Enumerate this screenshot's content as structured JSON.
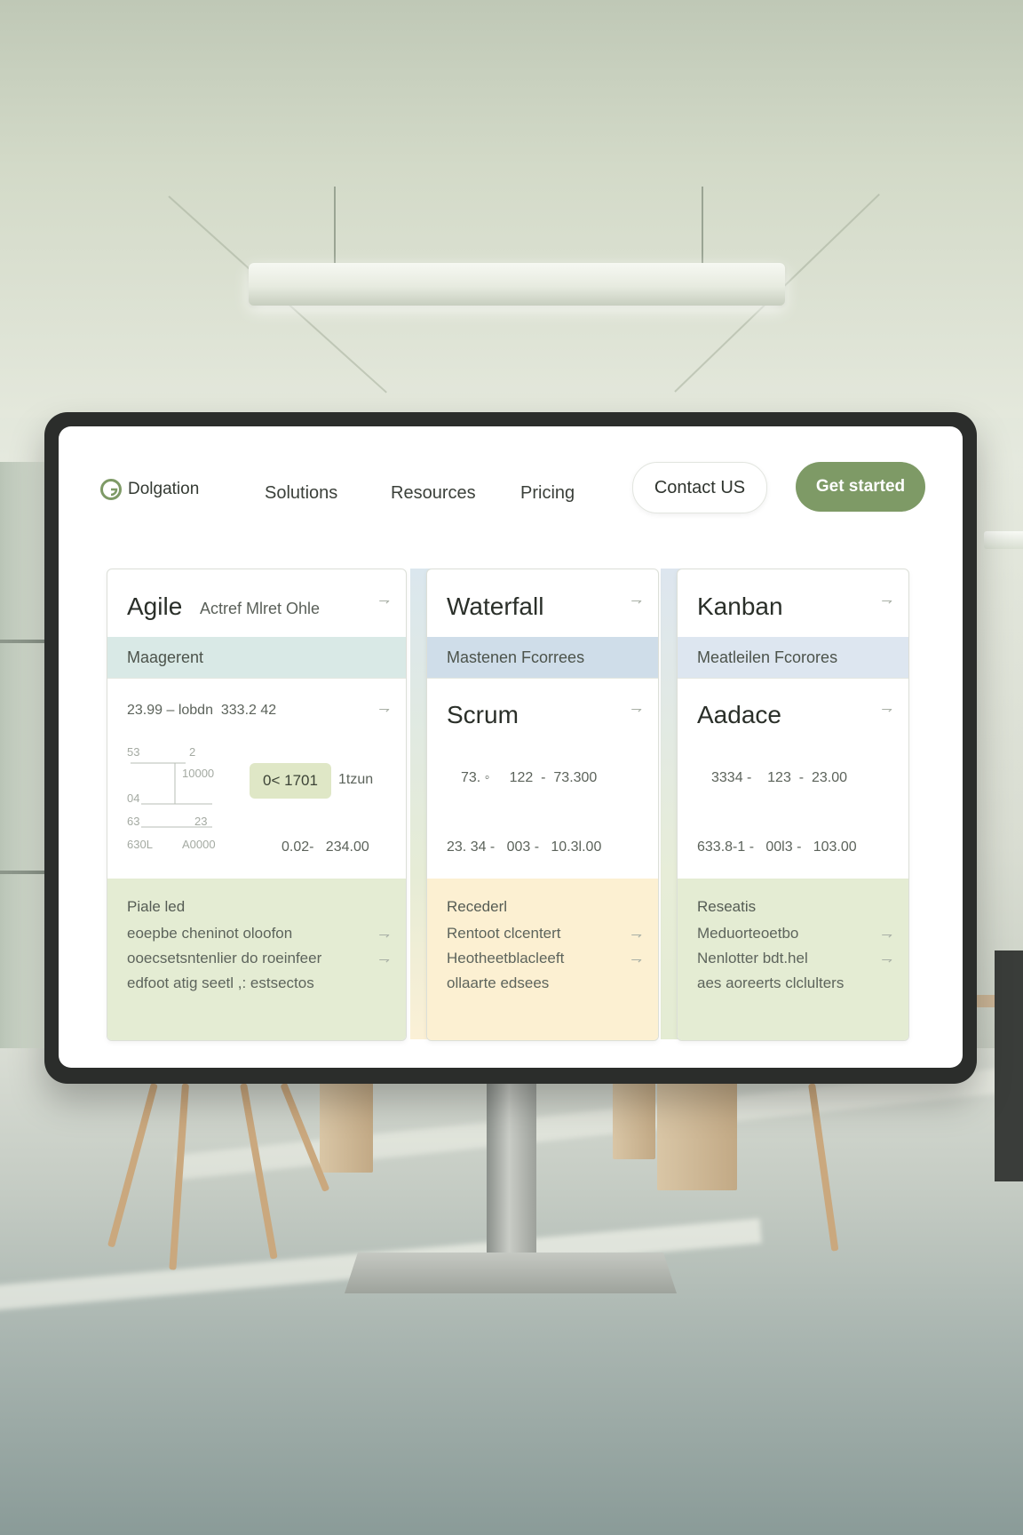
{
  "nav": {
    "brand": "Dolgation",
    "links": [
      "Solutions",
      "Resources",
      "Pricing"
    ],
    "contact": "Contact US",
    "cta": "Get started"
  },
  "colors": {
    "accent": "#7e9a66",
    "band_teal": "#d9e9e6",
    "band_blue": "#cfdde9",
    "band_light_blue": "#dde6f0",
    "foot_green": "#e4ecd3",
    "foot_yellow": "#fcf0d2"
  },
  "cards": [
    {
      "title": "Agile",
      "subtitle": "Actref Mlret Ohle",
      "band": "Maagerent",
      "mid_header": "23.99 – lobdn  333.2 42",
      "chart_labels": [
        "53",
        "2",
        "10000",
        "04",
        "63",
        "23",
        "630L",
        "A0000"
      ],
      "pill": "0< 1701",
      "pill_after": "1tzun",
      "row2": "0.02-   234.00",
      "foot_title": "Piale led",
      "foot_lines": [
        "eoepbe cheninot oloofon",
        "ooecsetsntenlier do roeinfeer",
        "edfoot atig seetl ,: estsectos"
      ]
    },
    {
      "title": "Waterfall",
      "band": "Mastenen Fcorrees",
      "mid_title": "Scrum",
      "row1": "73. ◦     122  -  73.300",
      "row2": "23. 34 -   003 -   10.3l.00",
      "foot_title": "Recederl",
      "foot_lines": [
        "Rentoot clcentert",
        "Heotheetblacleeft",
        "ollaarte edsees"
      ]
    },
    {
      "title": "Kanban",
      "band": "Meatleilen Fcorores",
      "mid_title": "Aadace",
      "row1": "3334 -    123  -  23.00",
      "row2": "633.8-1 -   00l3 -   103.00",
      "foot_title": "Reseatis",
      "foot_lines": [
        "Meduorteoetbo",
        "Nenlotter bdt.hel",
        "aes aoreerts clclulters"
      ]
    }
  ]
}
